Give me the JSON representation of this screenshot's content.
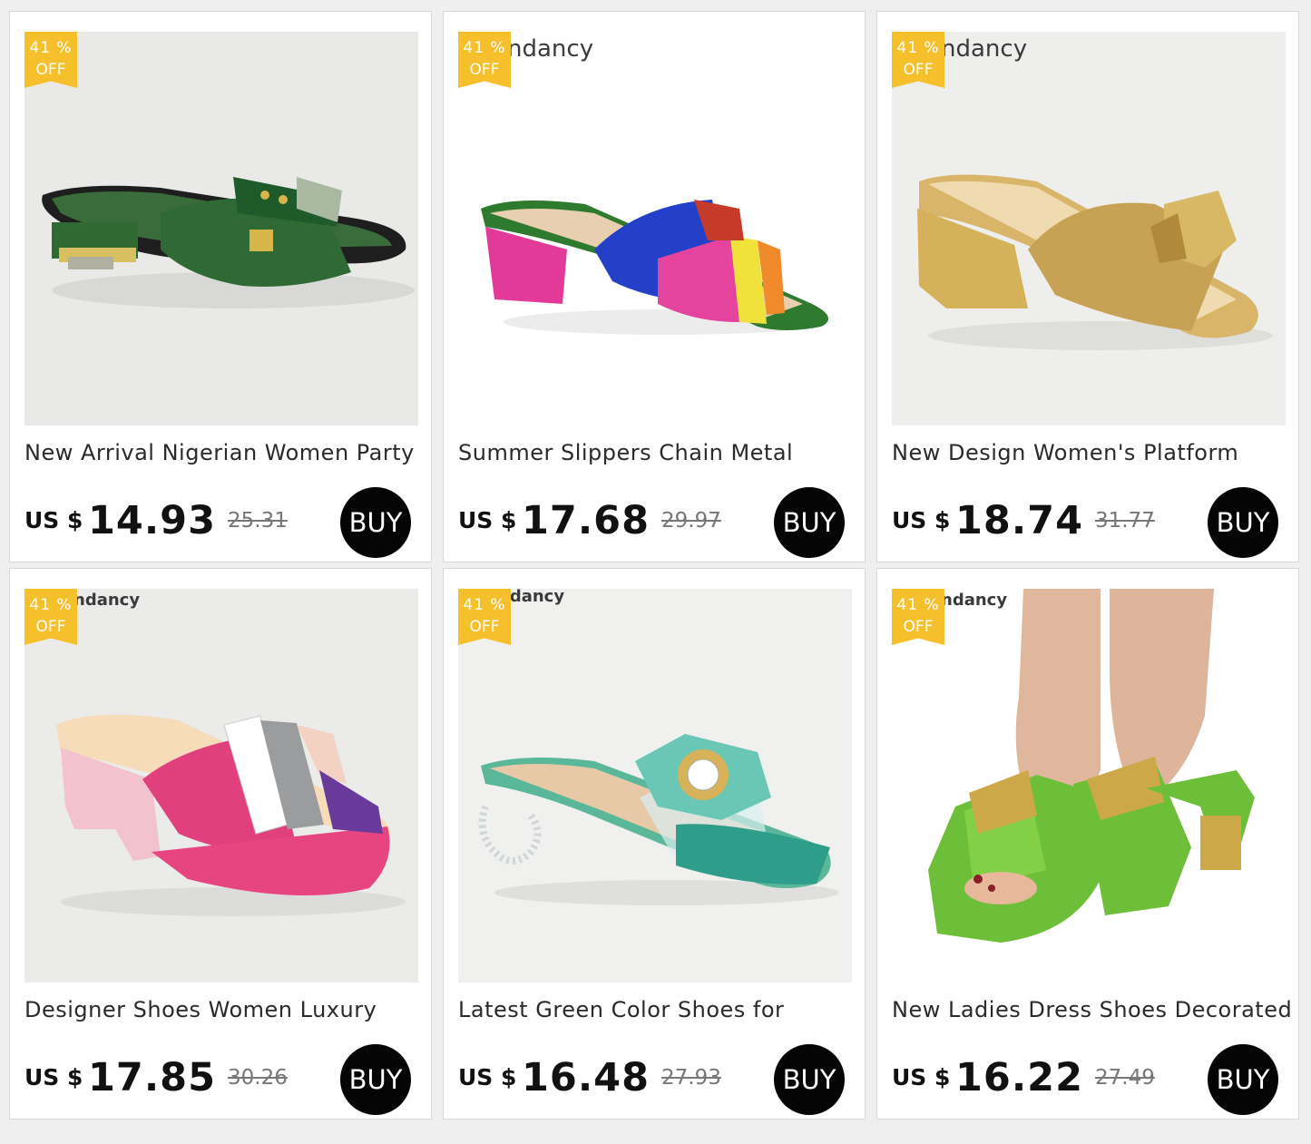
{
  "discount": {
    "percent": "41 %",
    "off": "OFF"
  },
  "currency": "US $",
  "buy_label": "BUY",
  "watermark": "ndancy",
  "products": [
    {
      "title": "New Arrival Nigerian Women Party",
      "price": "14.93",
      "old_price": "25.31"
    },
    {
      "title": "Summer Slippers Chain Metal",
      "price": "17.68",
      "old_price": "29.97"
    },
    {
      "title": "New Design Women's Platform",
      "price": "18.74",
      "old_price": "31.77"
    },
    {
      "title": "Designer Shoes Women Luxury",
      "price": "17.85",
      "old_price": "30.26"
    },
    {
      "title": "Latest Green Color Shoes for",
      "price": "16.48",
      "old_price": "27.93"
    },
    {
      "title": "New Ladies Dress Shoes Decorated",
      "price": "16.22",
      "old_price": "27.49"
    }
  ]
}
